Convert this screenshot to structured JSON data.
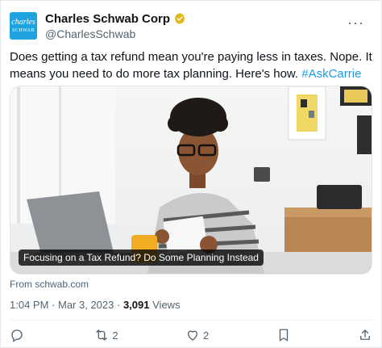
{
  "tweet": {
    "avatar_text_top": "charles",
    "avatar_text_bottom": "SCHWAB",
    "name": "Charles Schwab Corp",
    "handle": "@CharlesSchwab",
    "body_text": "Does getting a tax refund mean you're paying less in taxes. Nope. It means you need to do more tax planning. Here's how. ",
    "hashtag": "#AskCarrie",
    "media_caption": "Focusing on a Tax Refund? Do Some Planning Instead",
    "from_text": "From schwab.com",
    "time": "1:04 PM",
    "date": "Mar 3, 2023",
    "views_count": "3,091",
    "views_label": "Views"
  },
  "actions": {
    "reply_count": "",
    "retweet_count": "2",
    "like_count": "2"
  },
  "colors": {
    "accent": "#1d9bf0",
    "verified_gold": "#e2b719",
    "avatar_bg": "#1ea3e0"
  }
}
